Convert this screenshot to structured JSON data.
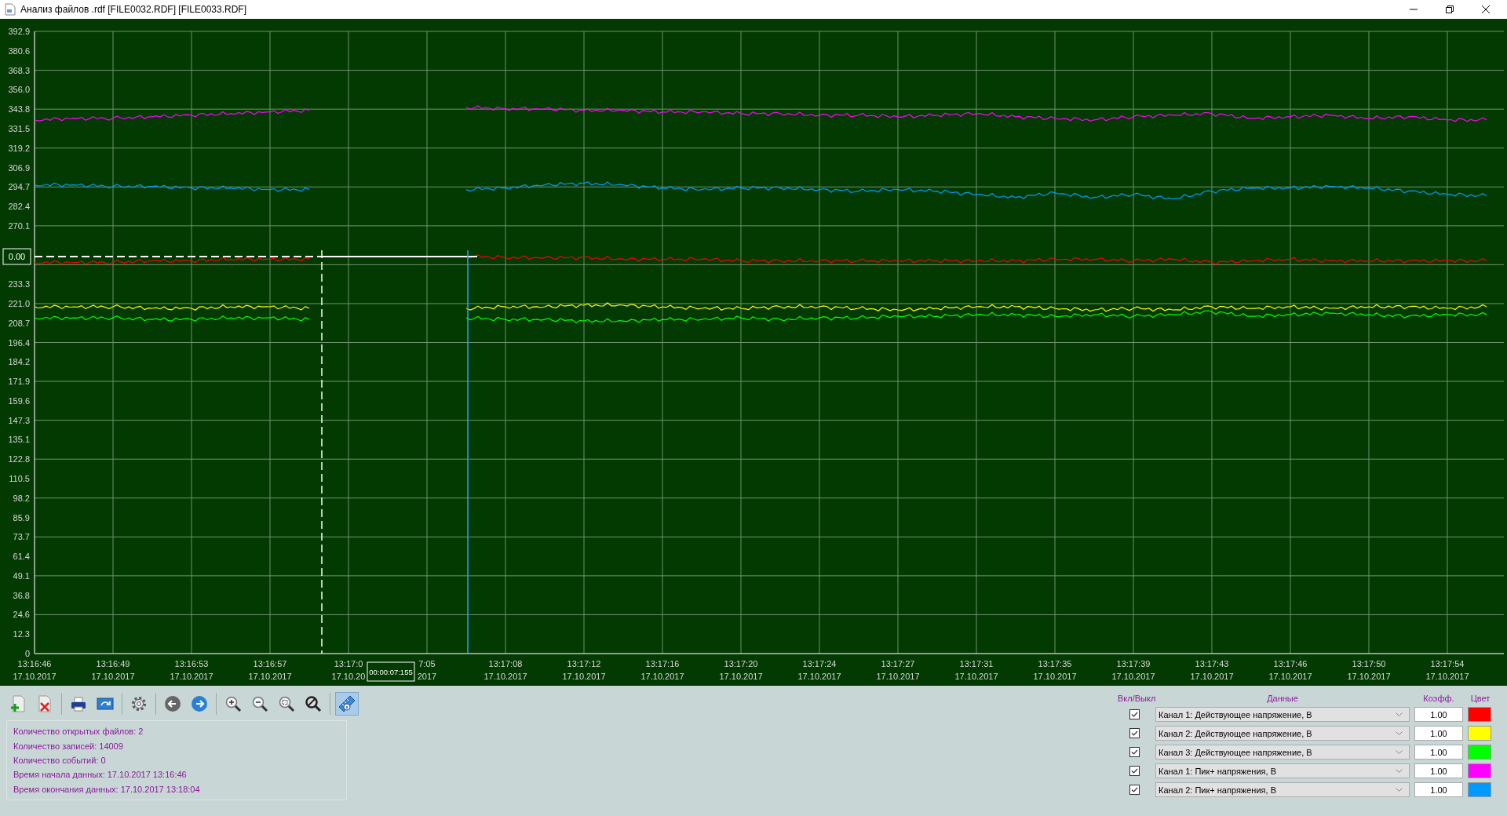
{
  "window": {
    "title": "Анализ файлов .rdf [FILE0032.RDF] [FILE0033.RDF]"
  },
  "chart": {
    "cursor": {
      "y_readout": "0.00",
      "delta": "00:00:07:155"
    },
    "x_dates": [
      "17.10.2017",
      "17.10.2017",
      "17.10.2017",
      "17.10.2017",
      "17.10.20",
      "2017",
      "17.10.2017",
      "17.10.2017",
      "17.10.2017",
      "17.10.2017",
      "17.10.2017",
      "17.10.2017",
      "17.10.2017",
      "17.10.2017",
      "17.10.2017",
      "17.10.2017",
      "17.10.2017",
      "17.10.2017",
      "17.10.2017"
    ],
    "chart_data": {
      "type": "line",
      "ylim": [
        0,
        392.9
      ],
      "grid": true,
      "ref_lines": [
        {
          "axis": "y",
          "value": 250.7
        }
      ],
      "categories": [
        "13:16:46",
        null,
        "13:16:49",
        null,
        "13:16:53",
        null,
        "13:16:57",
        null,
        "13:17:0",
        null,
        "7:05",
        null,
        "13:17:08",
        null,
        "13:17:12",
        null,
        "13:17:16",
        null,
        "13:17:20",
        null,
        "13:17:24",
        null,
        "13:17:27",
        null,
        "13:17:31",
        null,
        "13:17:35",
        null,
        "13:17:39",
        null,
        "13:17:43",
        null,
        "13:17:46",
        null,
        "13:17:50",
        null,
        "13:17:54",
        null
      ],
      "series": [
        {
          "color": "#ff0000",
          "values": [
            247,
            247,
            247,
            248,
            248,
            249,
            249,
            249,
            null,
            null,
            null,
            251,
            250,
            250,
            250,
            249,
            249,
            249,
            248,
            248,
            248,
            248,
            248,
            248,
            248,
            248,
            249,
            249,
            248,
            249,
            247,
            248,
            249,
            248,
            248,
            248,
            248,
            248
          ]
        },
        {
          "color": "#ffff00",
          "values": [
            219,
            219,
            219,
            218,
            218,
            219,
            219,
            218,
            null,
            null,
            null,
            218,
            219,
            219,
            220,
            220,
            219,
            218,
            218,
            219,
            219,
            218,
            217,
            218,
            219,
            219,
            218,
            217,
            218,
            217,
            219,
            218,
            219,
            218,
            219,
            219,
            218,
            219
          ]
        },
        {
          "color": "#00ff00",
          "values": [
            212,
            212,
            212,
            211,
            211,
            212,
            212,
            211,
            null,
            null,
            null,
            212,
            211,
            211,
            210,
            210,
            211,
            211,
            212,
            211,
            212,
            212,
            213,
            213,
            214,
            214,
            213,
            214,
            213,
            214,
            216,
            213,
            214,
            215,
            214,
            213,
            214,
            214
          ]
        },
        {
          "color": "#ff00ff",
          "values": [
            337,
            338,
            338,
            339,
            340,
            341,
            342,
            343,
            null,
            null,
            null,
            345,
            344,
            344,
            343,
            343,
            342,
            342,
            341,
            341,
            340,
            340,
            339,
            340,
            341,
            339,
            338,
            337,
            339,
            340,
            341,
            338,
            339,
            340,
            338,
            339,
            337,
            337
          ]
        },
        {
          "color": "#0099ff",
          "values": [
            296,
            296,
            295,
            295,
            294,
            294,
            293,
            293,
            null,
            null,
            null,
            293,
            294,
            296,
            297,
            296,
            294,
            293,
            294,
            294,
            293,
            292,
            293,
            292,
            290,
            288,
            291,
            288,
            290,
            287,
            292,
            294,
            294,
            295,
            294,
            292,
            290,
            289
          ]
        }
      ],
      "yticks": [
        {
          "value": 0,
          "label": "0"
        },
        {
          "value": 12.3,
          "label": "12.3"
        },
        {
          "value": 24.6,
          "label": "24.6"
        },
        {
          "value": 36.8,
          "label": "36.8"
        },
        {
          "value": 49.1,
          "label": "49.1"
        },
        {
          "value": 61.4,
          "label": "61.4"
        },
        {
          "value": 73.7,
          "label": "73.7"
        },
        {
          "value": 85.9,
          "label": "85.9"
        },
        {
          "value": 98.2,
          "label": "98.2"
        },
        {
          "value": 110.5,
          "label": "110.5"
        },
        {
          "value": 122.8,
          "label": "122.8"
        },
        {
          "value": 135.1,
          "label": "135.1"
        },
        {
          "value": 147.3,
          "label": "147.3"
        },
        {
          "value": 159.6,
          "label": "159.6"
        },
        {
          "value": 171.9,
          "label": "171.9"
        },
        {
          "value": 184.2,
          "label": "184.2"
        },
        {
          "value": 196.4,
          "label": "196.4"
        },
        {
          "value": 208.7,
          "label": "208.7"
        },
        {
          "value": 221.0,
          "label": "221.0"
        },
        {
          "value": 233.3,
          "label": "233.3"
        },
        {
          "value": 270.1,
          "label": "270.1"
        },
        {
          "value": 282.4,
          "label": "282.4"
        },
        {
          "value": 294.7,
          "label": "294.7"
        },
        {
          "value": 306.9,
          "label": "306.9"
        },
        {
          "value": 319.2,
          "label": "319.2"
        },
        {
          "value": 331.5,
          "label": "331.5"
        },
        {
          "value": 343.8,
          "label": "343.8"
        },
        {
          "value": 356.0,
          "label": "356.0"
        },
        {
          "value": 368.3,
          "label": "368.3"
        },
        {
          "value": 380.6,
          "label": "380.6"
        },
        {
          "value": 392.9,
          "label": "392.9"
        }
      ]
    }
  },
  "toolbar": [
    {
      "kind": "add-file",
      "selected": false
    },
    {
      "kind": "delete-file",
      "selected": false
    },
    {
      "kind": "separator"
    },
    {
      "kind": "print",
      "selected": false
    },
    {
      "kind": "export",
      "selected": false
    },
    {
      "kind": "separator"
    },
    {
      "kind": "settings",
      "selected": false
    },
    {
      "kind": "separator"
    },
    {
      "kind": "back",
      "selected": false
    },
    {
      "kind": "forward",
      "selected": false
    },
    {
      "kind": "separator"
    },
    {
      "kind": "zoom-in",
      "selected": false
    },
    {
      "kind": "zoom-out",
      "selected": false
    },
    {
      "kind": "zoom-box",
      "selected": false
    },
    {
      "kind": "zoom-reset",
      "selected": false
    },
    {
      "kind": "separator"
    },
    {
      "kind": "ruler-info",
      "selected": true
    }
  ],
  "info": [
    "Количество открытых файлов: 2",
    "Количество записей: 14009",
    "Количество событий: 0",
    "Время начала данных: 17.10.2017 13:16:46",
    "Время окончания данных: 17.10.2017 13:18:04"
  ],
  "channels": {
    "headers": [
      "Вкл/Выкл",
      "Данные",
      "Коэфф.",
      "Цвет"
    ],
    "rows": [
      {
        "checked": true,
        "label": "Канал 1: Действующее напряжение, В",
        "coef": "1.00",
        "color": "#ff0000"
      },
      {
        "checked": true,
        "label": "Канал 2: Действующее напряжение, В",
        "coef": "1.00",
        "color": "#ffff00"
      },
      {
        "checked": true,
        "label": "Канал 3: Действующее напряжение, В",
        "coef": "1.00",
        "color": "#00ff00"
      },
      {
        "checked": true,
        "label": "Канал 1: Пик+ напряжения, В",
        "coef": "1.00",
        "color": "#ff00ff"
      },
      {
        "checked": true,
        "label": "Канал 2: Пик+ напряжения, В",
        "coef": "1.00",
        "color": "#0099ff"
      }
    ]
  }
}
